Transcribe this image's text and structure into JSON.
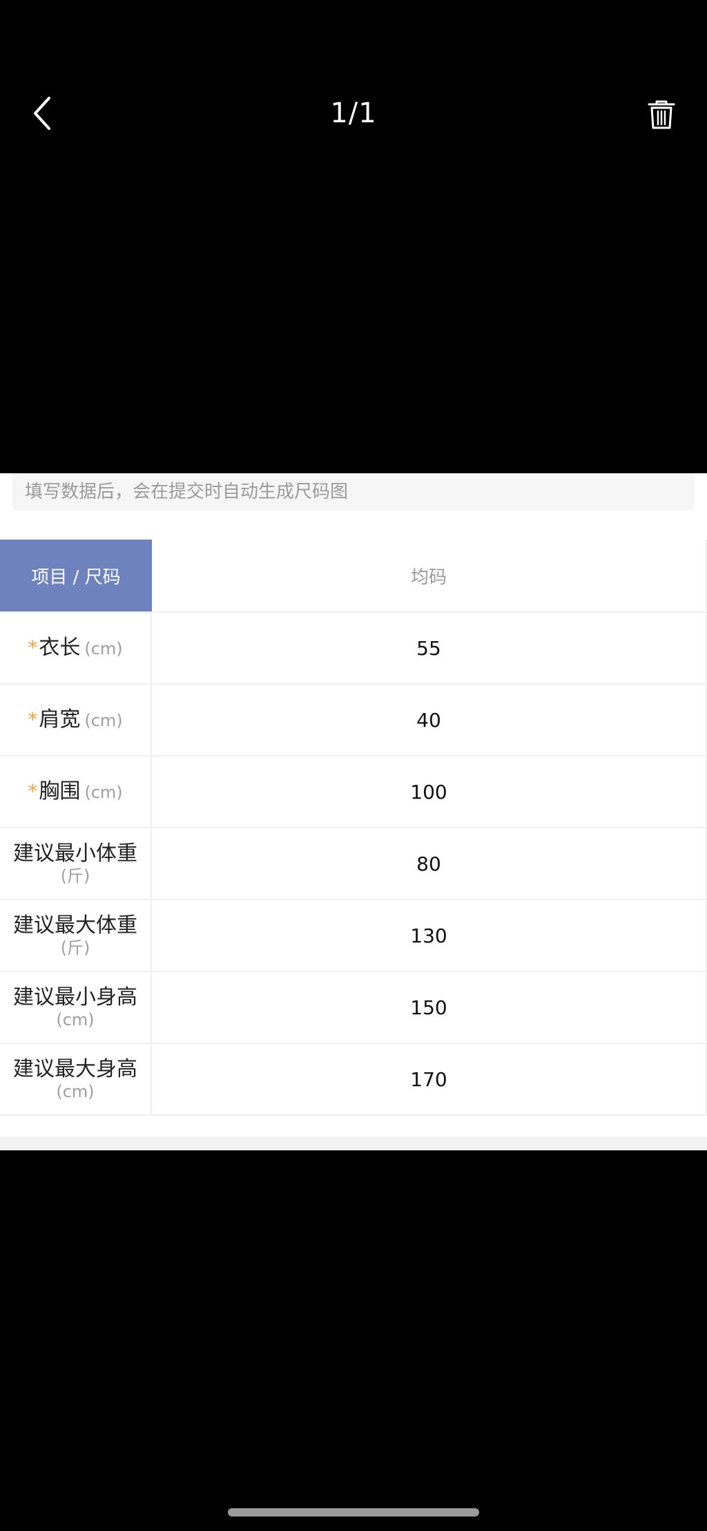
{
  "viewer": {
    "counter": "1/1",
    "back_icon": "chevron-left-icon",
    "delete_icon": "trash-icon"
  },
  "hint": "填写数据后，会在提交时自动生成尺码图",
  "table": {
    "header_label": "项目 / 尺码",
    "header_value": "均码",
    "rows": [
      {
        "label": "衣长",
        "unit": "(cm)",
        "value": "55",
        "required": true
      },
      {
        "label": "肩宽",
        "unit": "(cm)",
        "value": "40",
        "required": true
      },
      {
        "label": "胸围",
        "unit": "(cm)",
        "value": "100",
        "required": true
      },
      {
        "label": "建议最小体重",
        "unit": "(斤)",
        "value": "80",
        "required": false
      },
      {
        "label": "建议最大体重",
        "unit": "(斤)",
        "value": "130",
        "required": false
      },
      {
        "label": "建议最小身高",
        "unit": "(cm)",
        "value": "150",
        "required": false
      },
      {
        "label": "建议最大身高",
        "unit": "(cm)",
        "value": "170",
        "required": false
      }
    ],
    "required_mark": "*"
  },
  "colors": {
    "header_bg": "#6e82bd",
    "required_star": "#f0a23a"
  }
}
